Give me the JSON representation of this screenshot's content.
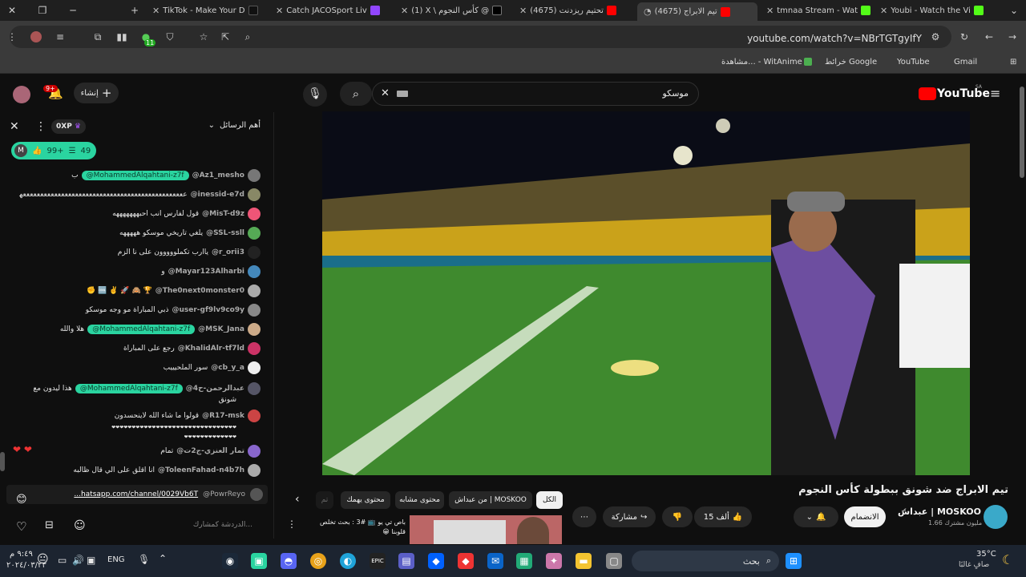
{
  "browser": {
    "tabs": [
      {
        "title": "TikTok - Make Your D",
        "active": false
      },
      {
        "title": "Catch JACOSport Liv",
        "active": false
      },
      {
        "title": "(1) X \\ كأس النجوم @",
        "active": false
      },
      {
        "title": "(4675) تحتيم ريزدنت",
        "active": false
      },
      {
        "title": "(4675) تيم الابراج",
        "active": true
      },
      {
        "title": "tmnaa Stream - Wat",
        "active": false
      },
      {
        "title": "Youbi - Watch the Vi",
        "active": false
      }
    ],
    "url": "youtube.com/watch?v=NBrTGTgyIfY",
    "extension_badge": "11",
    "bookmarks": [
      {
        "label": "Gmail"
      },
      {
        "label": "YouTube"
      },
      {
        "label": "خرائط Google"
      },
      {
        "label": "مشاهدة... - WitAnime"
      }
    ]
  },
  "youtube": {
    "logo_text": "YouTube",
    "region": "SA",
    "search_value": "موسكو",
    "create_label": "إنشاء",
    "notification_badge": "9+"
  },
  "chat": {
    "header_title": "أهم الرسائل",
    "xp_label": "0XP",
    "stats": {
      "likes": "99+",
      "messages": "49",
      "avatar_letter": "M"
    },
    "messages": [
      {
        "user": "@Az1_mesho",
        "mention": "@MohammedAlqahtani-z7f",
        "text": "ب",
        "color": "#777"
      },
      {
        "user": "@inessid-e7d",
        "mention": "",
        "text": "عععععععععععععععععععععععععععععععععععععععععععععععهههههههههههههههههههههه",
        "color": "#886"
      },
      {
        "user": "@MisT-d9z",
        "mention": "",
        "text": "قول لفارس انب احبهههههههه",
        "color": "#e57"
      },
      {
        "user": "@SSL-ssll",
        "mention": "",
        "text": "يلغي تاريخي موسكو هههههه",
        "color": "#5a5"
      },
      {
        "user": "@r_orii3",
        "mention": "",
        "text": "ياارب تكملووووون على نا الزم",
        "color": "#222"
      },
      {
        "user": "@Mayar123Alharbi",
        "mention": "",
        "text": "و",
        "color": "#48b"
      },
      {
        "user": "@The0next0monster0",
        "mention": "",
        "text": "🏆 🙈 🚀 ✌️ 🆒 ✊",
        "color": "#aaa"
      },
      {
        "user": "@user-gf9lv9co9y",
        "mention": "",
        "text": "ذبي المباراة مو وجه موسكو",
        "color": "#888"
      },
      {
        "user": "@MSK_Jana",
        "mention": "@MohammedAlqahtani-z7f",
        "text": "هلا والله",
        "color": "#ca8"
      },
      {
        "user": "@KhalidAlr-tf7ld",
        "mention": "",
        "text": "رجع على المباراة",
        "color": "#c36"
      },
      {
        "user": "@cb_y_a",
        "mention": "",
        "text": "سور الملحيييب",
        "color": "#eee"
      },
      {
        "user": "@عبدالرحمن-ح4",
        "mention": "@MohammedAlqahtani-z7f",
        "text": "هذا ليدون مع",
        "color": "#556"
      },
      {
        "user": "",
        "mention": "",
        "text": "شونق",
        "color": ""
      },
      {
        "user": "@R17-msk",
        "mention": "",
        "text": "قولوا ما شاء الله لاينحسدون",
        "color": "#c44"
      },
      {
        "user": "",
        "mention": "",
        "text": "❤❤❤❤❤❤❤❤❤❤❤❤❤❤❤❤❤❤❤❤❤❤❤❤❤❤❤❤❤❤❤",
        "color": ""
      },
      {
        "user": "",
        "mention": "",
        "text": "❤❤❤❤❤❤❤❤❤❤❤❤❤",
        "color": ""
      },
      {
        "user": "@تمار العنزي-ج2ت",
        "mention": "",
        "text": "تمام",
        "color": "#86c"
      },
      {
        "user": "@ToleenFahad-n4b7h",
        "mention": "",
        "text": "انا اقلق على الي قال ظالبه",
        "color": "#aaa"
      }
    ],
    "pinned": {
      "user": "@PowrReyo",
      "text": "...hatsapp.com/channel/0029Vb6T"
    },
    "input_placeholder": "الدردشة كمشارك..."
  },
  "video": {
    "title": "تيم الابراج ضد شونق ببطولة كأس النجوم",
    "channel": "عبداش | MOSKOO",
    "subscribers": "1.66 مليون مشترك",
    "join_label": "الانضمام",
    "likes": "15 ألف",
    "share_label": "مشاركة"
  },
  "related": {
    "chips": [
      {
        "label": "الكل",
        "active": true
      },
      {
        "label": "من عبداش | MOSKOO",
        "active": false
      },
      {
        "label": "محتوى مشابه",
        "active": false
      },
      {
        "label": "محتوى يهمك",
        "active": false
      },
      {
        "label": "تم",
        "active": false
      }
    ],
    "first_video_title": "باص تي يو 📺 #3 : بحث تخلص قلوبنا 😀"
  },
  "taskbar": {
    "search_placeholder": "بحث",
    "language": "ENG",
    "time": "٩:٤٩ م",
    "date": "٢٠٢٤/٠٣/٢٣",
    "weather_temp": "35°C",
    "weather_desc": "صافٍ غالبًا"
  }
}
